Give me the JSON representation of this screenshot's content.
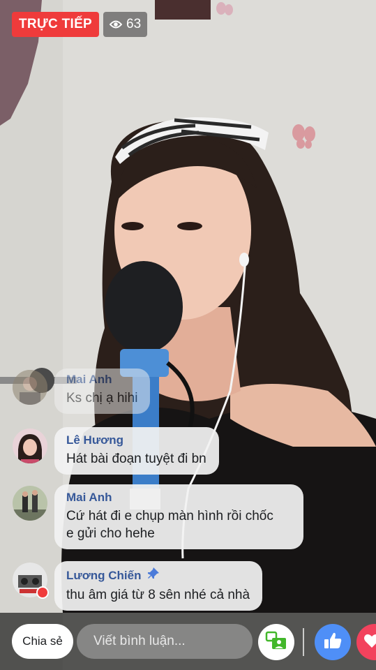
{
  "live": {
    "badge_label": "TRỰC TIẾP",
    "viewer_count": "63"
  },
  "comments": [
    {
      "author": "Mai Anh",
      "text": "Ks chị ạ hihi"
    },
    {
      "author": "Lê Hương",
      "text": "Hát bài đoạn tuyệt đi bn"
    },
    {
      "author": "Mai Anh",
      "text": "Cứ hát đi e chụp màn hình rồi chốc e gửi cho hehe",
      "text_lines": [
        "Cứ hát đi e chụp màn hình rồi chốc",
        "e gửi cho hehe"
      ]
    },
    {
      "author": "Lương Chiến",
      "text": "thu âm giá từ 8 sên nhé cả nhà",
      "pinned": true
    }
  ],
  "bottom_bar": {
    "share_label": "Chia sẻ",
    "comment_placeholder": "Viết bình luận..."
  },
  "icons": {
    "viewer": "eye-icon",
    "pin": "pin-icon",
    "guest": "invite-guest-icon",
    "like": "thumbs-up-icon",
    "love": "heart-icon"
  },
  "colors": {
    "live_red": "#ef3b3b",
    "author_blue": "#365899",
    "like_blue": "#4f8ff7",
    "love_red": "#f2425d",
    "guest_green": "#42b72a"
  }
}
